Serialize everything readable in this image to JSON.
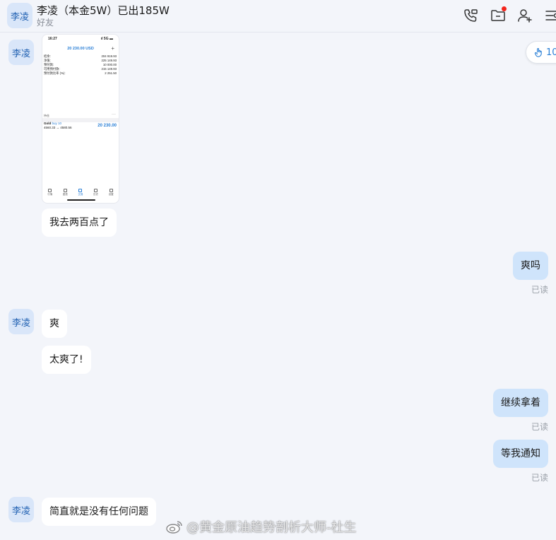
{
  "header": {
    "avatar_text": "李凌",
    "title": "李凌（本金5W）已出185W",
    "subtitle": "好友",
    "icons": [
      "phone-video-icon",
      "folder-icon",
      "add-user-icon",
      "menu-icon"
    ],
    "notification_dot_color": "#f3251c"
  },
  "reaction": {
    "icon": "hand-pointer-icon",
    "count": "10"
  },
  "image_message": {
    "status_time": "16:27",
    "status_right": "ıl 5G ▬",
    "balance": "20 230.00 USD",
    "plus": "+",
    "rows": [
      {
        "label": "结余:",
        "value": "204 919.93"
      },
      {
        "label": "净值:",
        "value": "225 149.93"
      },
      {
        "label": "预付款:",
        "value": "10 000.00"
      },
      {
        "label": "可用预付款:",
        "value": "215 149.93"
      },
      {
        "label": "预付款比率 (%):",
        "value": "2 251.50"
      }
    ],
    "positions_label": "持仓",
    "dots": "···",
    "gold_title": "Gold",
    "gold_side": "buy 10",
    "gold_prices": "4560.33 → 4580.56",
    "gold_profit": "20 230.00",
    "nav": [
      "行情",
      "图表",
      "交易",
      "历史",
      "设置"
    ],
    "nav_active_index": 2
  },
  "messages": [
    {
      "side": "in",
      "text": "我去两百点了"
    },
    {
      "side": "out",
      "text": "爽吗",
      "status": "已读"
    },
    {
      "side": "in",
      "text": "爽",
      "avatar_text": "李凌"
    },
    {
      "side": "in",
      "text": "太爽了!"
    },
    {
      "side": "out",
      "text": "继续拿着",
      "status": "已读"
    },
    {
      "side": "out",
      "text": "等我通知",
      "status": "已读"
    },
    {
      "side": "in",
      "text": "简直就是没有任何问题",
      "avatar_text": "李凌"
    }
  ],
  "first_avatar_text": "李凌",
  "watermark": {
    "icon": "weibo-icon",
    "text": "@黄金原油趋势剖析大师-杜生"
  },
  "colors": {
    "background": "#f3f5fa",
    "incoming_bubble": "#ffffff",
    "outgoing_bubble": "#cfe4fb",
    "accent": "#2a7fd6"
  }
}
